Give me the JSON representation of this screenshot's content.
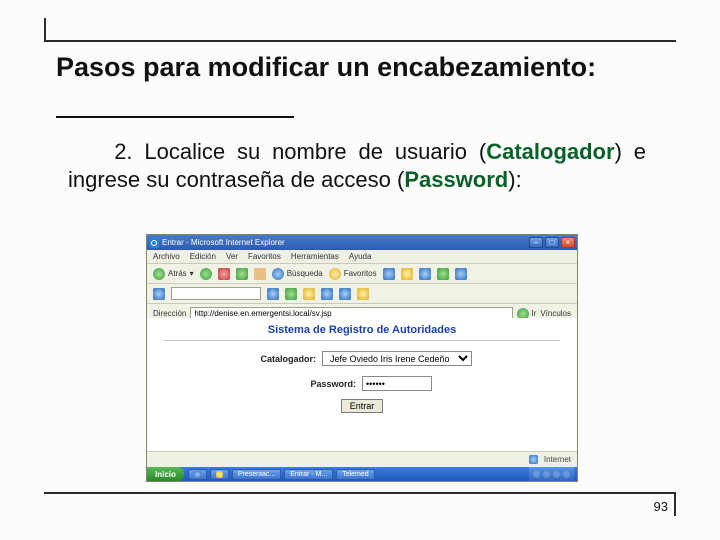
{
  "slide": {
    "title": "Pasos para modificar un encabezamiento:",
    "body_prefix": "2. Localice su nombre de usuario (",
    "hl1": "Catalogador",
    "body_mid": ") e ingrese su contraseña de acceso (",
    "hl2": "Password",
    "body_suffix": "):",
    "page_number": "93"
  },
  "browser": {
    "window_title": "Entrar - Microsoft Internet Explorer",
    "menu": {
      "archivo": "Archivo",
      "edicion": "Edición",
      "ver": "Ver",
      "favoritos": "Favoritos",
      "herramientas": "Herramientas",
      "ayuda": "Ayuda"
    },
    "tb": {
      "atras": "Atrás",
      "busqueda": "Búsqueda",
      "favoritos": "Favoritos"
    },
    "addr_label": "Dirección",
    "addr_value": "http://denise.en.emergentsi.local/sv.jsp",
    "go": "Ir",
    "links": "Vínculos",
    "sys_title": "Sistema de Registro de Autoridades",
    "form": {
      "catalogador_label": "Catalogador:",
      "catalogador_value": "Jefe Oviedo Iris Irene Cedeño",
      "password_label": "Password:",
      "password_value": "••••••",
      "enter": "Entrar"
    },
    "status": {
      "internet": "Internet"
    },
    "taskbar": {
      "start": "Inicio",
      "items": [
        "",
        "",
        "Presentac...",
        "Entrar - M...",
        "Telemed"
      ]
    }
  }
}
